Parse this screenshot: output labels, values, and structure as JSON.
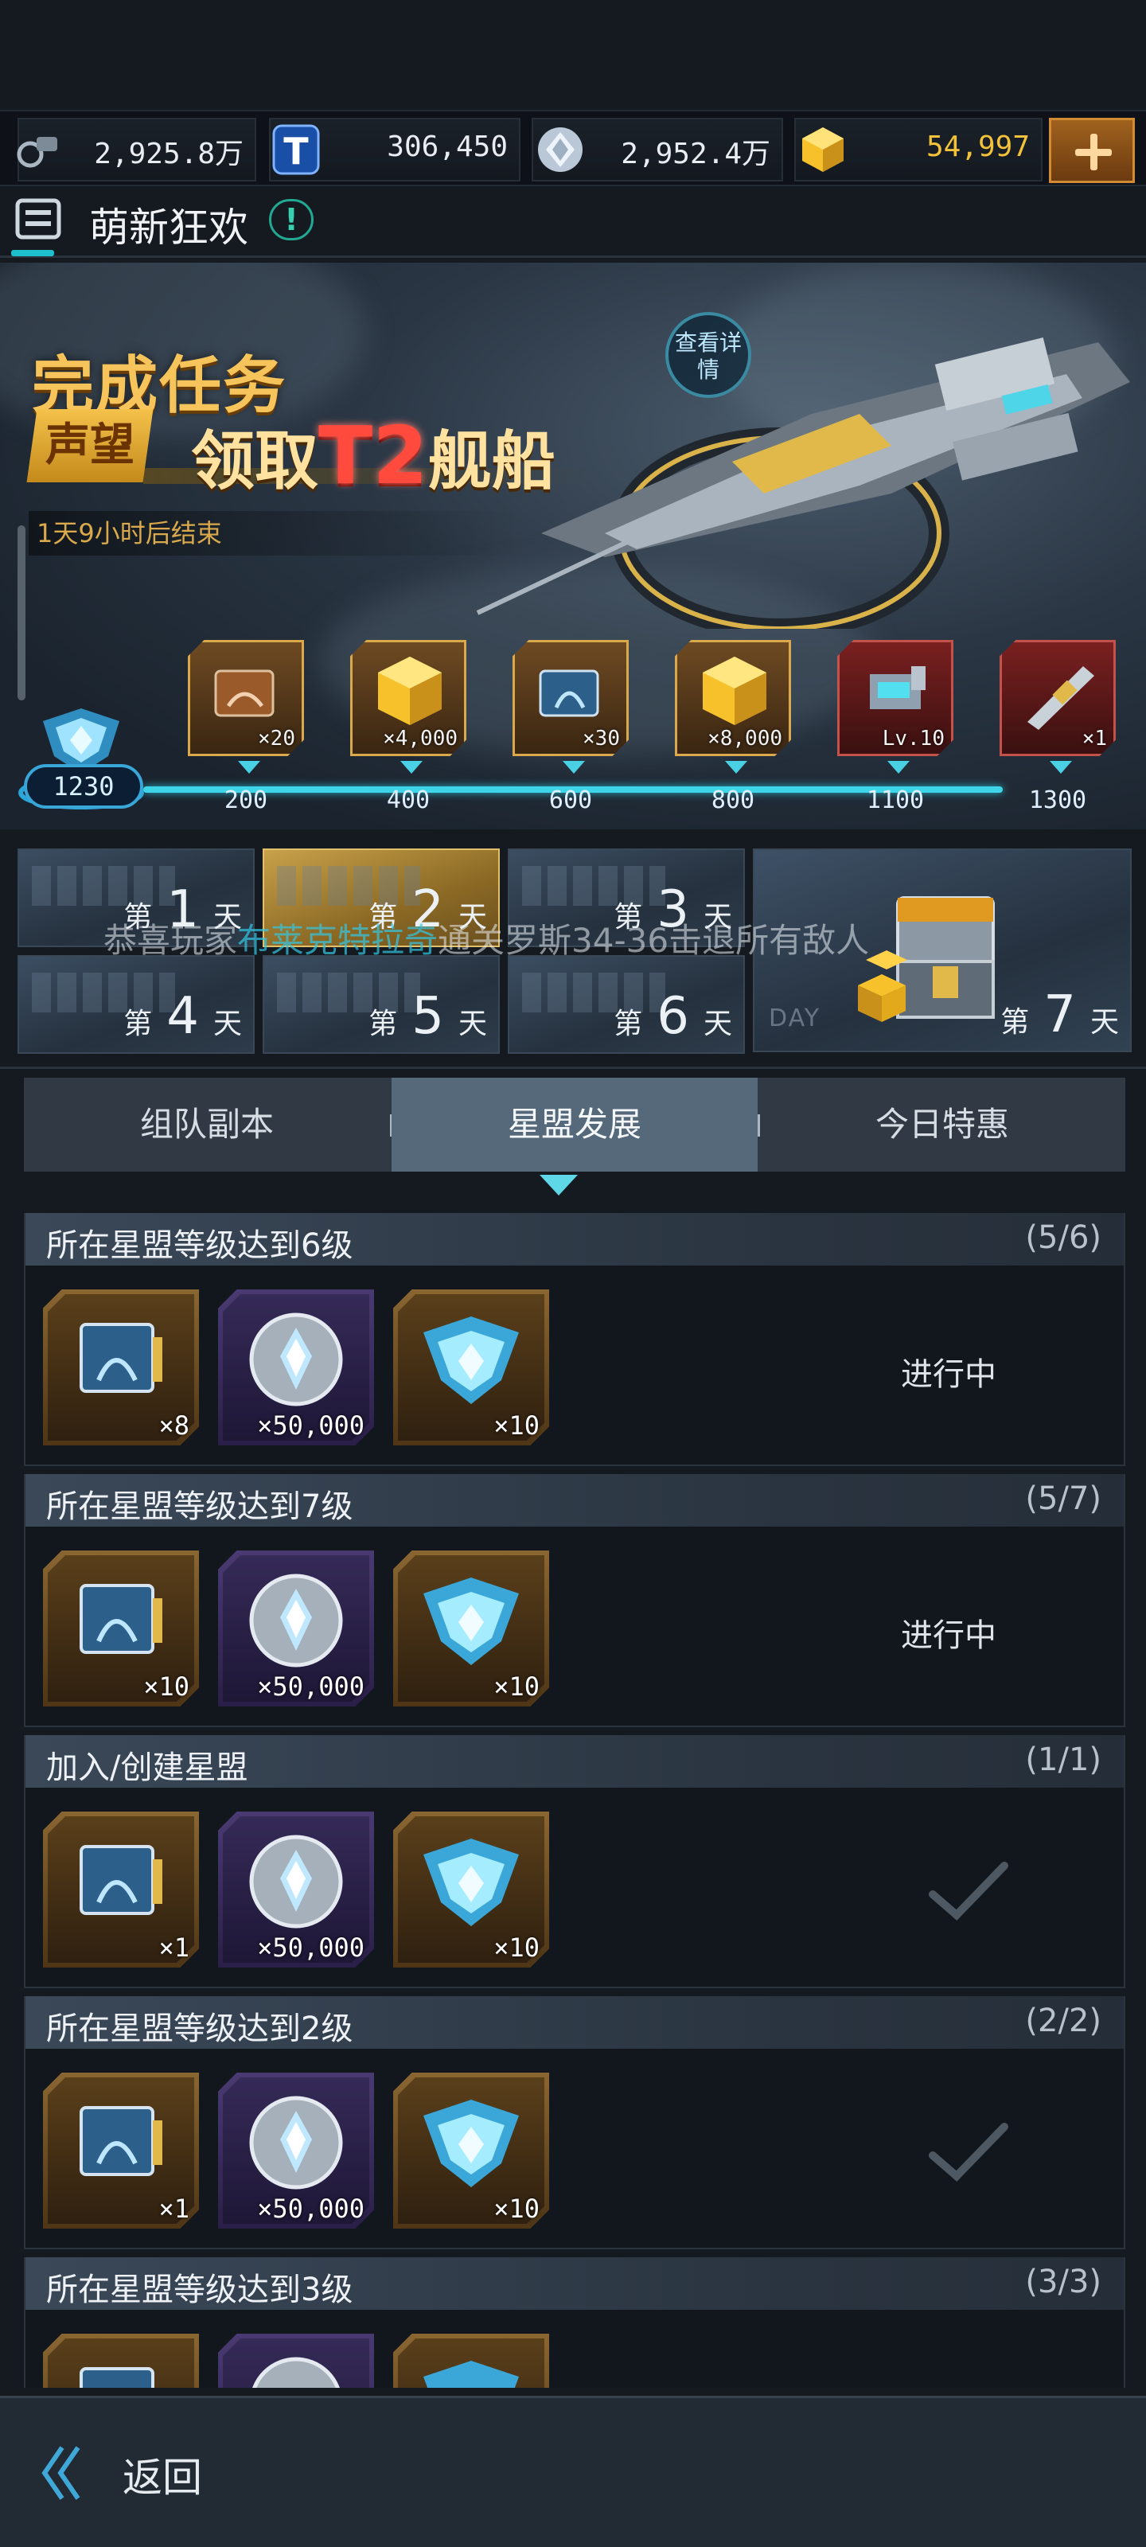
{
  "resources": {
    "fuel": "2,925.8万",
    "tokens": "306,450",
    "crystal": "2,952.4万",
    "gold": "54,997"
  },
  "header": {
    "title": "萌新狂欢",
    "info": "!"
  },
  "banner": {
    "headline": "完成任务",
    "tag": "声望",
    "subline_pre": "领取",
    "subline_t2": "T2",
    "subline_post": "舰船",
    "detail_button": "查看详情",
    "countdown": "1天9小时后结束",
    "current_score": "1230",
    "milestones": [
      {
        "points": "200",
        "qty": "×20",
        "icon": "blueprint-icon",
        "style": "gold"
      },
      {
        "points": "400",
        "qty": "×4,000",
        "icon": "gold-cube-icon",
        "style": "gold"
      },
      {
        "points": "600",
        "qty": "×30",
        "icon": "blueprint-icon",
        "style": "gold"
      },
      {
        "points": "800",
        "qty": "×8,000",
        "icon": "gold-cube-icon",
        "style": "gold"
      },
      {
        "points": "1100",
        "qty": "Lv.10",
        "icon": "module-icon",
        "style": "red"
      },
      {
        "points": "1300",
        "qty": "×1",
        "icon": "ship-icon",
        "style": "red"
      }
    ]
  },
  "days": {
    "prefix": "第",
    "suffix": "天",
    "numbers": [
      "1",
      "2",
      "3",
      "4",
      "5",
      "6",
      "7"
    ],
    "day7_tag": "DAY",
    "active_day": 2
  },
  "marquee": {
    "pre": "恭喜玩家",
    "name": "布莱克特拉奇",
    "post": "通关罗斯34-36击退所有敌人"
  },
  "tabs": [
    {
      "label": "组队副本",
      "active": false
    },
    {
      "label": "星盟发展",
      "active": true
    },
    {
      "label": "今日特惠",
      "active": false
    }
  ],
  "tasks": [
    {
      "title": "所在星盟等级达到6级",
      "progress": "(5/6)",
      "status": "进行中",
      "done": false,
      "rewards": [
        "×8",
        "×50,000",
        "×10"
      ]
    },
    {
      "title": "所在星盟等级达到7级",
      "progress": "(5/7)",
      "status": "进行中",
      "done": false,
      "rewards": [
        "×10",
        "×50,000",
        "×10"
      ]
    },
    {
      "title": "加入/创建星盟",
      "progress": "(1/1)",
      "status": "",
      "done": true,
      "rewards": [
        "×1",
        "×50,000",
        "×10"
      ]
    },
    {
      "title": "所在星盟等级达到2级",
      "progress": "(2/2)",
      "status": "",
      "done": true,
      "rewards": [
        "×1",
        "×50,000",
        "×10"
      ]
    },
    {
      "title": "所在星盟等级达到3级",
      "progress": "(3/3)",
      "status": "",
      "done": true,
      "rewards": [
        "",
        "",
        ""
      ]
    }
  ],
  "footer": {
    "back_label": "返回"
  },
  "colors": {
    "accent": "#3fd5e8",
    "gold": "#f1c23a",
    "tab_active": "#56697a"
  }
}
